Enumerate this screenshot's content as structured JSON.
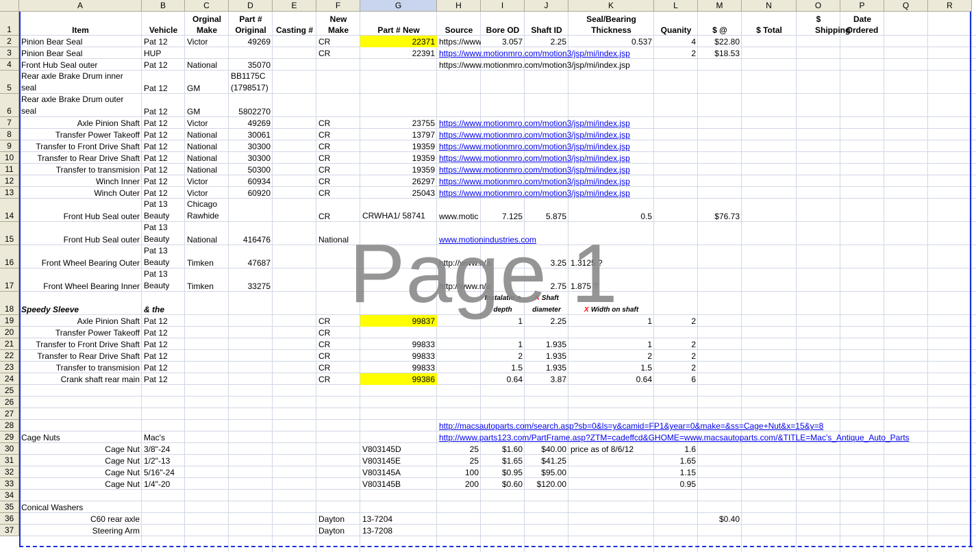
{
  "columns": [
    "A",
    "B",
    "C",
    "D",
    "E",
    "F",
    "G",
    "H",
    "I",
    "J",
    "K",
    "L",
    "M",
    "N",
    "O",
    "P",
    "Q",
    "R"
  ],
  "rows": [
    "1",
    "2",
    "3",
    "4",
    "5",
    "6",
    "7",
    "8",
    "9",
    "10",
    "11",
    "12",
    "13",
    "14",
    "15",
    "16",
    "17",
    "18",
    "19",
    "20",
    "21",
    "22",
    "23",
    "24",
    "25",
    "26",
    "27",
    "28",
    "29",
    "30",
    "31",
    "32",
    "33",
    "34",
    "35",
    "36",
    "37"
  ],
  "header": {
    "item": "Item",
    "vehicle": "Vehicle",
    "orig_make": "Orginal Make",
    "part_orig": "Part # Original",
    "casting": "Casting #",
    "new_make": "New Make",
    "part_new": "Part # New",
    "source": "Source",
    "bore_od": "Bore OD",
    "shaft_id": "Shaft ID",
    "thickness": "Seal/Bearing Thickness",
    "quantity": "Quanity",
    "price_each": "$ @",
    "total": "$ Total",
    "shipping": "$ Shipping",
    "date_ordered": "Date Ordered"
  },
  "cells": {
    "A2": "Pinion Bear Seal",
    "B2": "Pat 12",
    "C2": "Victor",
    "D2": "49269",
    "F2": "CR",
    "G2": "22371",
    "H2": "https://www",
    "I2": "3.057",
    "J2": "2.25",
    "K2": "0.537",
    "L2": "4",
    "M2": "$22.80",
    "A3": "Pinion Bear Seal",
    "B3": "HUP",
    "F3": "CR",
    "G3": "22391",
    "H3": "https://www.motionmro.com/motion3/jsp/mi/index.jsp",
    "L3": "2",
    "M3": "$18.53",
    "A4": "Front Hub Seal outer",
    "B4": "Pat 12",
    "C4": "National",
    "D4": "35070",
    "H4": "https://www.motionmro.com/motion3/jsp/mi/index.jsp",
    "A5": "Rear axle Brake Drum inner seal",
    "B5": "Pat 12",
    "C5": "GM",
    "D5": "BB1175C (1798517)",
    "A6": "Rear axle Brake Drum outer seal",
    "B6": "Pat 12",
    "C6": "GM",
    "D6": "5802270",
    "A7": "Axle Pinion Shaft",
    "B7": "Pat 12",
    "C7": "Victor",
    "D7": "49269",
    "F7": "CR",
    "G7": "23755",
    "H7": "https://www.motionmro.com/motion3/jsp/mi/index.jsp",
    "A8": "Transfer Power Takeoff",
    "B8": "Pat 12",
    "C8": "National",
    "D8": "30061",
    "F8": "CR",
    "G8": "13797",
    "H8": "https://www.motionmro.com/motion3/jsp/mi/index.jsp",
    "A9": "Transfer to Front Drive Shaft",
    "B9": "Pat 12",
    "C9": "National",
    "D9": "30300",
    "F9": "CR",
    "G9": "19359",
    "H9": "https://www.motionmro.com/motion3/jsp/mi/index.jsp",
    "A10": "Transfer to  Rear Drive Shaft",
    "B10": "Pat 12",
    "C10": "National",
    "D10": "30300",
    "F10": "CR",
    "G10": "19359",
    "H10": "https://www.motionmro.com/motion3/jsp/mi/index.jsp",
    "A11": "Transfer to transmision",
    "B11": "Pat 12",
    "C11": "National",
    "D11": "50300",
    "F11": "CR",
    "G11": "19359",
    "H11": "https://www.motionmro.com/motion3/jsp/mi/index.jsp",
    "A12": "Winch Inner",
    "B12": "Pat 12",
    "C12": "Victor",
    "D12": "60934",
    "F12": "CR",
    "G12": "26297",
    "H12": "https://www.motionmro.com/motion3/jsp/mi/index.jsp",
    "A13": "Winch Outer",
    "B13": "Pat 12",
    "C13": "Victor",
    "D13": "60920",
    "F13": "CR",
    "G13": "25043",
    "H13": "https://www.motionmro.com/motion3/jsp/mi/index.jsp",
    "A14": "Front Hub Seal outer",
    "B14": "Pat 13 Beauty",
    "C14": "Chicago Rawhide",
    "F14": "CR",
    "G14": "CRWHA1/ 58741",
    "H14": "www.motic",
    "I14": "7.125",
    "J14": "5.875",
    "K14": "0.5",
    "M14": "$76.73",
    "A15": "Front Hub Seal outer",
    "B15": "Pat 13 Beauty",
    "C15": "National",
    "D15": "416476",
    "F15": "National",
    "H15": "www.motionindustries.com",
    "A16": "Front Wheel Bearing Outer",
    "B16": "Pat 13 Beauty",
    "C16": "Timken",
    "D16": "47687",
    "H16": "http://www.n/a",
    "J16": "3.25",
    "K16": "1.3125 ?",
    "A17": "Front Wheel Bearing Inner",
    "B17": "Pat 13 Beauty",
    "C17": "Timken",
    "D17": "33275",
    "H17": "http://www.n/a",
    "J17": "2.75",
    "K17": "1.875 ?",
    "A18": "Speedy Sleeve",
    "B18": "& the",
    "I18_mark": "Z",
    "I18": "Instalatio n depth",
    "J18_mark": "A",
    "J18": "Shaft diameter",
    "K18_mark": "X",
    "K18": "Width on shaft",
    "A19": "Axle Pinion Shaft",
    "B19": "Pat 12",
    "F19": "CR",
    "G19": "99837",
    "I19": "1",
    "J19": "2.25",
    "K19": "1",
    "L19": "2",
    "A20": "Transfer Power Takeoff",
    "B20": "Pat 12",
    "F20": "CR",
    "A21": "Transfer to Front Drive Shaft",
    "B21": "Pat 12",
    "F21": "CR",
    "G21": "99833",
    "I21": "1",
    "J21": "1.935",
    "K21": "1",
    "L21": "2",
    "A22": "Transfer to  Rear Drive Shaft",
    "B22": "Pat 12",
    "F22": "CR",
    "G22": "99833",
    "I22": "2",
    "J22": "1.935",
    "K22": "2",
    "L22": "2",
    "A23": "Transfer to transmision",
    "B23": "Pat 12",
    "F23": "CR",
    "G23": "99833",
    "I23": "1.5",
    "J23": "1.935",
    "K23": "1.5",
    "L23": "2",
    "A24": "Crank shaft rear main",
    "B24": "Pat 12",
    "F24": "CR",
    "G24": "99386",
    "I24": "0.64",
    "J24": "3.87",
    "K24": "0.64",
    "L24": "6",
    "H28": "http://macsautoparts.com/search.asp?sb=0&ls=y&camid=FP1&year=0&make=&ss=Cage+Nut&x=15&y=8",
    "A29": "Cage Nuts",
    "B29": "Mac's",
    "H29": "http://www.parts123.com/PartFrame.asp?ZTM=cadeffcd&GHOME=www.macsautoparts.com/&TITLE=Mac's_Antique_Auto_Parts",
    "A30": "Cage Nut",
    "B30": "3/8\"-24",
    "G30": "V803145D",
    "H30": "25",
    "I30": "$1.60",
    "J30": "$40.00",
    "K30": "price as of 8/6/12",
    "L30": "1.6",
    "A31": "Cage Nut",
    "B31": "1/2\"-13",
    "G31": "V803145E",
    "H31": "25",
    "I31": "$1.65",
    "J31": "$41.25",
    "L31": "1.65",
    "A32": "Cage Nut",
    "B32": "5/16\"-24",
    "G32": "V803145A",
    "H32": "100",
    "I32": "$0.95",
    "J32": "$95.00",
    "L32": "1.15",
    "A33": "Cage Nut",
    "B33": "1/4\"-20",
    "G33": "V803145B",
    "H33": "200",
    "I33": "$0.60",
    "J33": "$120.00",
    "L33": "0.95",
    "A35": "Conical Washers",
    "A36": "C60 rear axle",
    "F36": "Dayton",
    "G36": "13-7204",
    "M36": "$0.40",
    "A37": "Steering Arm",
    "F37": "Dayton",
    "G37": "13-7208"
  },
  "watermark": "Page 1",
  "colors": {
    "highlight": "#ffff00",
    "link": "#0000ee",
    "page_break": "#1a2fd6",
    "header_bg": "#ece9d8",
    "selected_col_bg": "#c9d5ee",
    "gridline": "#d0d7e5"
  }
}
